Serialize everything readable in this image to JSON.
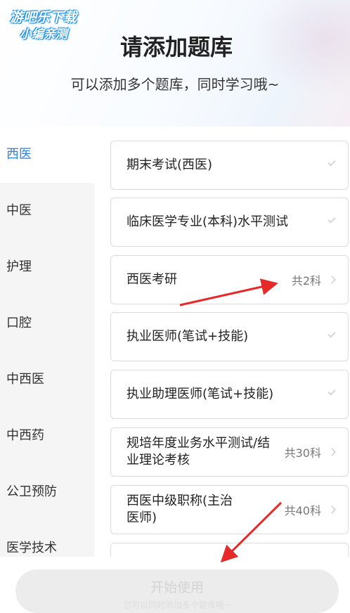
{
  "watermark": {
    "line1": "游吧乐下载",
    "line2": "小编亲测"
  },
  "header": {
    "title": "请添加题库",
    "subtitle": "可以添加多个题库，同时学习哦~"
  },
  "sidebar": {
    "items": [
      {
        "label": "西医",
        "active": true
      },
      {
        "label": "中医",
        "active": false
      },
      {
        "label": "护理",
        "active": false
      },
      {
        "label": "口腔",
        "active": false
      },
      {
        "label": "中西医",
        "active": false
      },
      {
        "label": "中西药",
        "active": false
      },
      {
        "label": "公卫预防",
        "active": false
      },
      {
        "label": "医学技术",
        "active": false
      }
    ]
  },
  "banks": [
    {
      "name": "期末考试(西医)",
      "count": "",
      "indicator": "check-icon"
    },
    {
      "name": "临床医学专业(本科)水平测试",
      "count": "",
      "indicator": "check-icon"
    },
    {
      "name": "西医考研",
      "count": "共2科",
      "indicator": "chevron-right-icon"
    },
    {
      "name": "执业医师(笔试+技能)",
      "count": "",
      "indicator": "check-icon"
    },
    {
      "name": "执业助理医师(笔试+技能)",
      "count": "",
      "indicator": "check-icon"
    },
    {
      "name": "规培年度业务水平测试/结业理论考核",
      "count": "共30科",
      "indicator": "chevron-right-icon"
    },
    {
      "name": "西医中级职称(主治医师)",
      "count": "共40科",
      "indicator": "chevron-right-icon"
    }
  ],
  "footer": {
    "start_label": "开始使用",
    "hint": "您可以同时添加多个题库哦~"
  },
  "colors": {
    "accent": "#2f7fe6",
    "annotation_arrow": "#e52a2a"
  }
}
